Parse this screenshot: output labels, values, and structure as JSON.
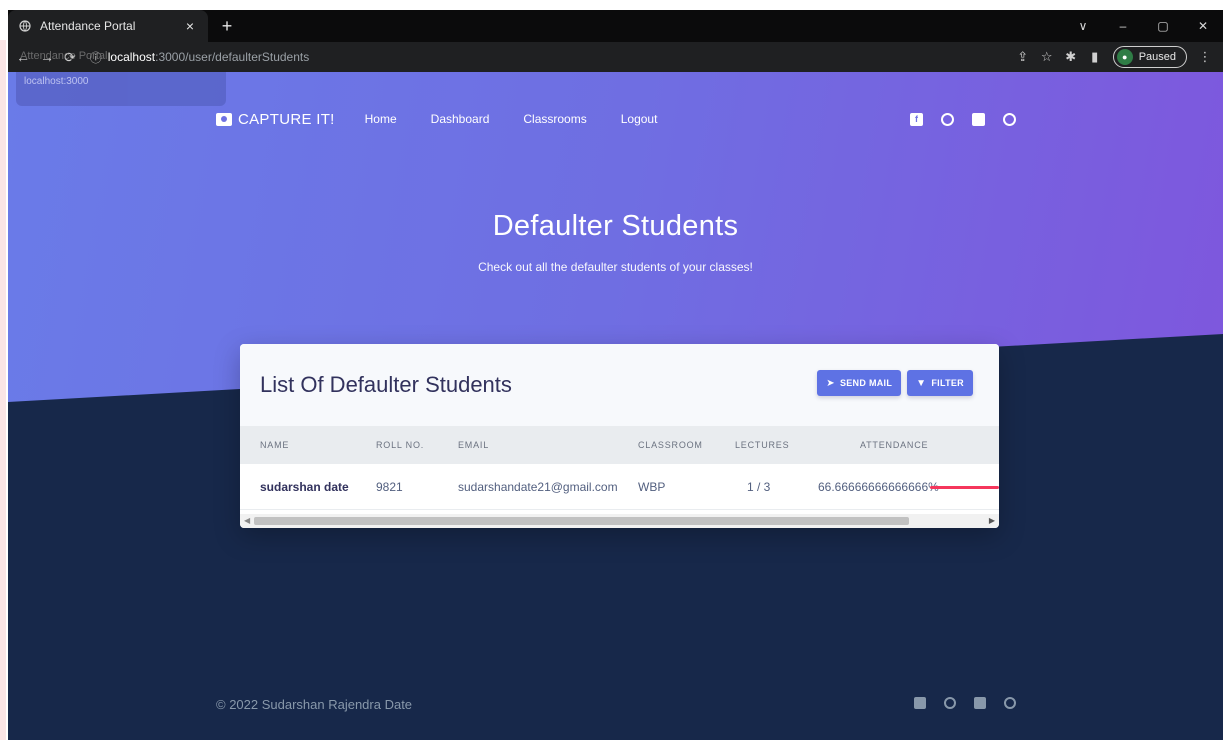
{
  "browser": {
    "tab_title": "Attendance Portal",
    "tab_close": "×",
    "new_tab": "+",
    "url_host": "localhost",
    "url_path": ":3000/user/defaulterStudents",
    "ghost_title": "Attendance Portal",
    "tooltip": "localhost:3000",
    "profile_status": "Paused"
  },
  "navbar": {
    "brand": "CAPTURE IT!",
    "links": [
      "Home",
      "Dashboard",
      "Classrooms",
      "Logout"
    ]
  },
  "hero": {
    "title": "Defaulter Students",
    "subtitle": "Check out all the defaulter students of your classes!"
  },
  "card": {
    "title": "List Of Defaulter Students",
    "send_mail": "SEND MAIL",
    "filter": "FILTER",
    "columns": [
      "NAME",
      "ROLL NO.",
      "EMAIL",
      "CLASSROOM",
      "LECTURES",
      "ATTENDANCE"
    ],
    "rows": [
      {
        "name": "sudarshan date",
        "roll": "9821",
        "email": "sudarshandate21@gmail.com",
        "classroom": "WBP",
        "lectures": "1 / 3",
        "attendance": "66.66666666666666%"
      }
    ]
  },
  "footer": {
    "copyright": "© 2022 Sudarshan Rajendra Date"
  },
  "colors": {
    "primary": "#5e72e4",
    "danger": "#f5365c",
    "dark_bg": "#17284a"
  }
}
